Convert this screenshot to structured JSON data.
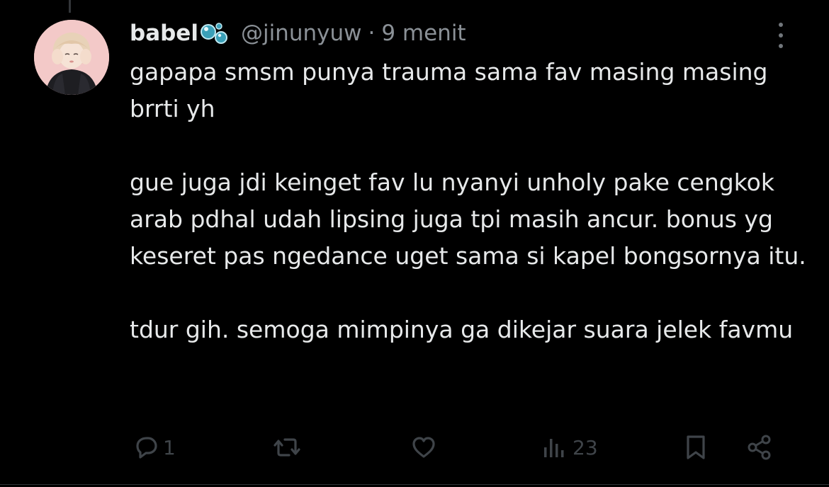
{
  "tweet": {
    "display_name": "babel",
    "name_emoji_icon": "bubbles-icon",
    "handle": "@jinunyuw",
    "separator": "·",
    "time": "9 menit",
    "more_icon": "more-vertical-icon",
    "paragraphs": [
      "gapapa smsm punya trauma sama fav masing masing brrti yh",
      "gue juga jdi keinget fav lu nyanyi unholy pake cengkok arab pdhal udah lipsing juga tpi masih ancur. bonus yg keseret pas ngedance uget sama si kapel bongsornya itu.",
      "tdur gih. semoga mimpinya ga dikejar suara jelek favmu"
    ]
  },
  "actions": {
    "reply": {
      "icon": "reply-icon",
      "count": "1"
    },
    "repost": {
      "icon": "repost-icon",
      "count": ""
    },
    "like": {
      "icon": "heart-icon",
      "count": ""
    },
    "views": {
      "icon": "views-icon",
      "count": "23"
    },
    "bookmark": {
      "icon": "bookmark-icon"
    },
    "share": {
      "icon": "share-icon"
    }
  },
  "colors": {
    "background": "#000000",
    "text": "#e7e9ea",
    "muted": "#8b9197",
    "action_dim": "#3f4449"
  }
}
